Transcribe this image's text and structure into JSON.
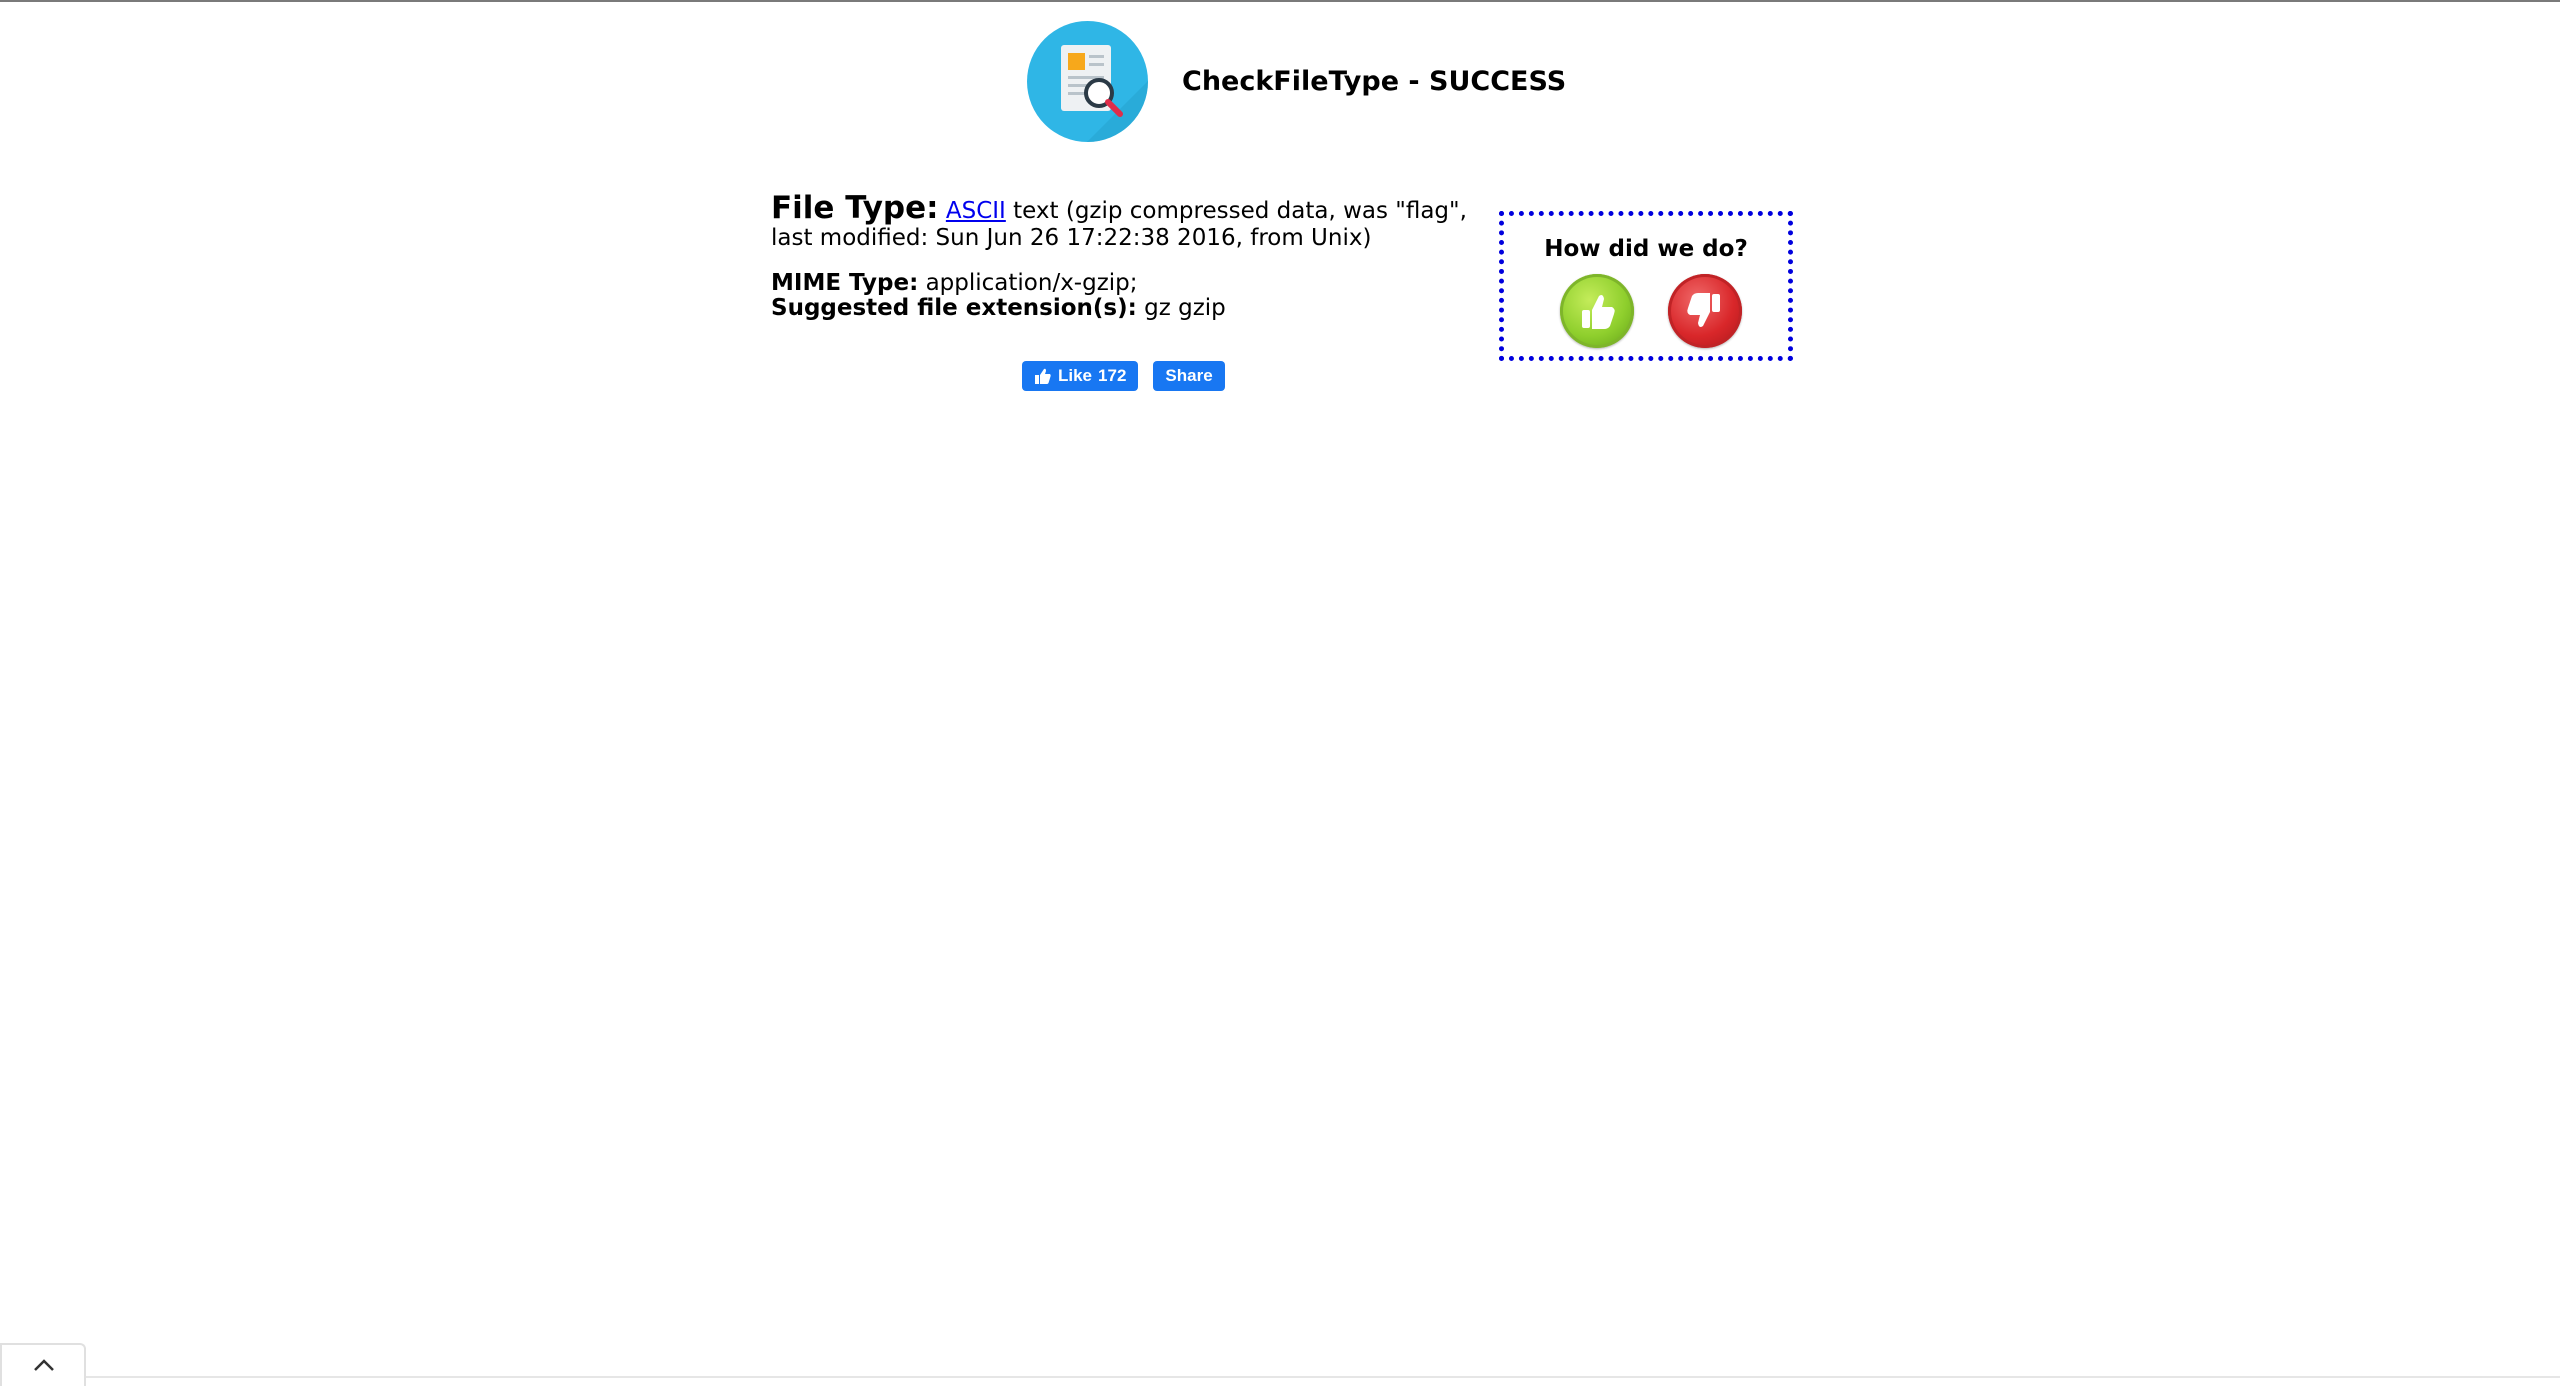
{
  "header": {
    "title": "CheckFileType - SUCCESS",
    "logo_icon": "file-search-icon",
    "logo_color": "#2fb6e6"
  },
  "result": {
    "file_type_label": "File Type:",
    "file_type_link": "ASCII",
    "file_type_text": " text (gzip compressed data, was \"flag\", last modified: Sun Jun 26 17:22:38 2016, from Unix)",
    "mime_label": "MIME Type:",
    "mime_value": " application/x-gzip;",
    "ext_label": "Suggested file extension(s):",
    "ext_value": " gz gzip"
  },
  "social": {
    "like_label": "Like",
    "like_count": "172",
    "share_label": "Share",
    "brand_color": "#1877f2"
  },
  "feedback": {
    "question": "How did we do?",
    "up_icon": "thumbs-up-icon",
    "down_icon": "thumbs-down-icon",
    "border_color": "#0000dd"
  },
  "footer": {
    "scroll_icon": "chevron-up-icon"
  }
}
